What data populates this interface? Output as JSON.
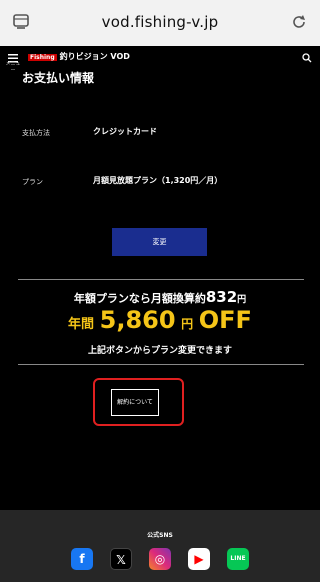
{
  "browser": {
    "url": "vod.fishing-v.jp"
  },
  "nav": {
    "menu_label": "メニュー",
    "logo_mark": "Fishing",
    "logo_text": "釣りビジョン VOD"
  },
  "page": {
    "title": "お支払い情報"
  },
  "payment": {
    "method_label": "支払方法",
    "method_value": "クレジットカード",
    "plan_label": "プラン",
    "plan_value": "月額見放題プラン（1,320円／月）",
    "change_button": "変更"
  },
  "promo": {
    "line1_prefix": "年額プランなら月額換算約",
    "line1_amount": "832",
    "line1_yen": "円",
    "line2_prefix": "年間",
    "line2_amount": "5,860",
    "line2_yen": "円",
    "line2_off": "OFF",
    "line3": "上記ボタンからプラン変更できます"
  },
  "cancel": {
    "button": "解約について"
  },
  "footer": {
    "sns_title": "公式SNS",
    "sns": [
      {
        "name": "facebook",
        "glyph": "f",
        "color": "#1877f2"
      },
      {
        "name": "x",
        "glyph": "𝕏",
        "color": "#000000"
      },
      {
        "name": "instagram",
        "glyph": "◎",
        "color": "#d6249f"
      },
      {
        "name": "youtube",
        "glyph": "▶",
        "color": "#ff0000"
      },
      {
        "name": "line",
        "glyph": "LINE",
        "color": "#06c755"
      }
    ]
  }
}
